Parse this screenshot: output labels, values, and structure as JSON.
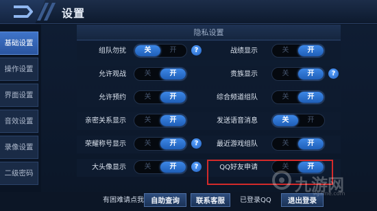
{
  "header": {
    "title": "设置",
    "back_icon": "back-arrow-icon"
  },
  "sidebar": {
    "items": [
      {
        "label": "基础设置",
        "active": true
      },
      {
        "label": "操作设置",
        "active": false
      },
      {
        "label": "界面设置",
        "active": false
      },
      {
        "label": "音效设置",
        "active": false
      },
      {
        "label": "录像设置",
        "active": false
      },
      {
        "label": "二级密码",
        "active": false
      }
    ]
  },
  "panel": {
    "title": "隐私设置"
  },
  "toggle_text": {
    "off": "关",
    "on": "开",
    "help": "?"
  },
  "settings_left": [
    {
      "label": "组队勿扰",
      "state": "off",
      "help": true
    },
    {
      "label": "允许观战",
      "state": "on",
      "help": false
    },
    {
      "label": "允许预约",
      "state": "on",
      "help": false
    },
    {
      "label": "亲密关系显示",
      "state": "on",
      "help": false
    },
    {
      "label": "荣耀称号显示",
      "state": "on",
      "help": true
    },
    {
      "label": "大头像显示",
      "state": "on",
      "help": true
    }
  ],
  "settings_right": [
    {
      "label": "战绩显示",
      "state": "on",
      "help": false
    },
    {
      "label": "贵族显示",
      "state": "on",
      "help": true
    },
    {
      "label": "综合频道组队",
      "state": "on",
      "help": false
    },
    {
      "label": "发送语音消息",
      "state": "off",
      "help": false
    },
    {
      "label": "最近游戏组队",
      "state": "on",
      "help": false
    },
    {
      "label": "QQ好友申请",
      "state": "on",
      "help": false,
      "highlighted": true
    }
  ],
  "bottom": {
    "help_text": "有困难请点我",
    "self_query_button": "自助查询",
    "contact_button": "联系客服",
    "login_status": "已登录QQ",
    "logout_button": "退出登录"
  },
  "watermark": {
    "text": "九游网",
    "url": "9game.com"
  },
  "colors": {
    "accent": "#2f74d6",
    "highlight_border": "#d42a2a",
    "background": "#0a1424"
  }
}
